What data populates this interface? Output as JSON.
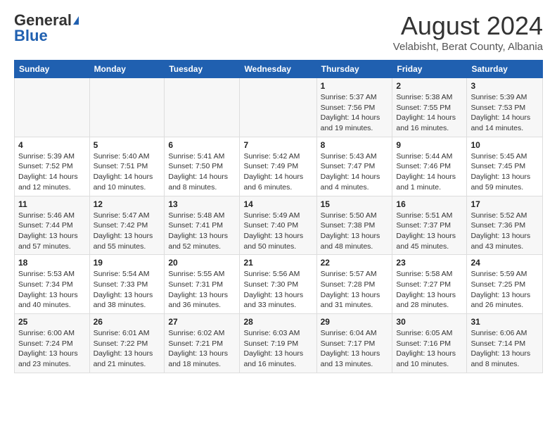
{
  "header": {
    "logo_general": "General",
    "logo_blue": "Blue",
    "title": "August 2024",
    "location": "Velabisht, Berat County, Albania"
  },
  "weekdays": [
    "Sunday",
    "Monday",
    "Tuesday",
    "Wednesday",
    "Thursday",
    "Friday",
    "Saturday"
  ],
  "weeks": [
    [
      {
        "num": "",
        "info": ""
      },
      {
        "num": "",
        "info": ""
      },
      {
        "num": "",
        "info": ""
      },
      {
        "num": "",
        "info": ""
      },
      {
        "num": "1",
        "info": "Sunrise: 5:37 AM\nSunset: 7:56 PM\nDaylight: 14 hours\nand 19 minutes."
      },
      {
        "num": "2",
        "info": "Sunrise: 5:38 AM\nSunset: 7:55 PM\nDaylight: 14 hours\nand 16 minutes."
      },
      {
        "num": "3",
        "info": "Sunrise: 5:39 AM\nSunset: 7:53 PM\nDaylight: 14 hours\nand 14 minutes."
      }
    ],
    [
      {
        "num": "4",
        "info": "Sunrise: 5:39 AM\nSunset: 7:52 PM\nDaylight: 14 hours\nand 12 minutes."
      },
      {
        "num": "5",
        "info": "Sunrise: 5:40 AM\nSunset: 7:51 PM\nDaylight: 14 hours\nand 10 minutes."
      },
      {
        "num": "6",
        "info": "Sunrise: 5:41 AM\nSunset: 7:50 PM\nDaylight: 14 hours\nand 8 minutes."
      },
      {
        "num": "7",
        "info": "Sunrise: 5:42 AM\nSunset: 7:49 PM\nDaylight: 14 hours\nand 6 minutes."
      },
      {
        "num": "8",
        "info": "Sunrise: 5:43 AM\nSunset: 7:47 PM\nDaylight: 14 hours\nand 4 minutes."
      },
      {
        "num": "9",
        "info": "Sunrise: 5:44 AM\nSunset: 7:46 PM\nDaylight: 14 hours\nand 1 minute."
      },
      {
        "num": "10",
        "info": "Sunrise: 5:45 AM\nSunset: 7:45 PM\nDaylight: 13 hours\nand 59 minutes."
      }
    ],
    [
      {
        "num": "11",
        "info": "Sunrise: 5:46 AM\nSunset: 7:44 PM\nDaylight: 13 hours\nand 57 minutes."
      },
      {
        "num": "12",
        "info": "Sunrise: 5:47 AM\nSunset: 7:42 PM\nDaylight: 13 hours\nand 55 minutes."
      },
      {
        "num": "13",
        "info": "Sunrise: 5:48 AM\nSunset: 7:41 PM\nDaylight: 13 hours\nand 52 minutes."
      },
      {
        "num": "14",
        "info": "Sunrise: 5:49 AM\nSunset: 7:40 PM\nDaylight: 13 hours\nand 50 minutes."
      },
      {
        "num": "15",
        "info": "Sunrise: 5:50 AM\nSunset: 7:38 PM\nDaylight: 13 hours\nand 48 minutes."
      },
      {
        "num": "16",
        "info": "Sunrise: 5:51 AM\nSunset: 7:37 PM\nDaylight: 13 hours\nand 45 minutes."
      },
      {
        "num": "17",
        "info": "Sunrise: 5:52 AM\nSunset: 7:36 PM\nDaylight: 13 hours\nand 43 minutes."
      }
    ],
    [
      {
        "num": "18",
        "info": "Sunrise: 5:53 AM\nSunset: 7:34 PM\nDaylight: 13 hours\nand 40 minutes."
      },
      {
        "num": "19",
        "info": "Sunrise: 5:54 AM\nSunset: 7:33 PM\nDaylight: 13 hours\nand 38 minutes."
      },
      {
        "num": "20",
        "info": "Sunrise: 5:55 AM\nSunset: 7:31 PM\nDaylight: 13 hours\nand 36 minutes."
      },
      {
        "num": "21",
        "info": "Sunrise: 5:56 AM\nSunset: 7:30 PM\nDaylight: 13 hours\nand 33 minutes."
      },
      {
        "num": "22",
        "info": "Sunrise: 5:57 AM\nSunset: 7:28 PM\nDaylight: 13 hours\nand 31 minutes."
      },
      {
        "num": "23",
        "info": "Sunrise: 5:58 AM\nSunset: 7:27 PM\nDaylight: 13 hours\nand 28 minutes."
      },
      {
        "num": "24",
        "info": "Sunrise: 5:59 AM\nSunset: 7:25 PM\nDaylight: 13 hours\nand 26 minutes."
      }
    ],
    [
      {
        "num": "25",
        "info": "Sunrise: 6:00 AM\nSunset: 7:24 PM\nDaylight: 13 hours\nand 23 minutes."
      },
      {
        "num": "26",
        "info": "Sunrise: 6:01 AM\nSunset: 7:22 PM\nDaylight: 13 hours\nand 21 minutes."
      },
      {
        "num": "27",
        "info": "Sunrise: 6:02 AM\nSunset: 7:21 PM\nDaylight: 13 hours\nand 18 minutes."
      },
      {
        "num": "28",
        "info": "Sunrise: 6:03 AM\nSunset: 7:19 PM\nDaylight: 13 hours\nand 16 minutes."
      },
      {
        "num": "29",
        "info": "Sunrise: 6:04 AM\nSunset: 7:17 PM\nDaylight: 13 hours\nand 13 minutes."
      },
      {
        "num": "30",
        "info": "Sunrise: 6:05 AM\nSunset: 7:16 PM\nDaylight: 13 hours\nand 10 minutes."
      },
      {
        "num": "31",
        "info": "Sunrise: 6:06 AM\nSunset: 7:14 PM\nDaylight: 13 hours\nand 8 minutes."
      }
    ]
  ]
}
